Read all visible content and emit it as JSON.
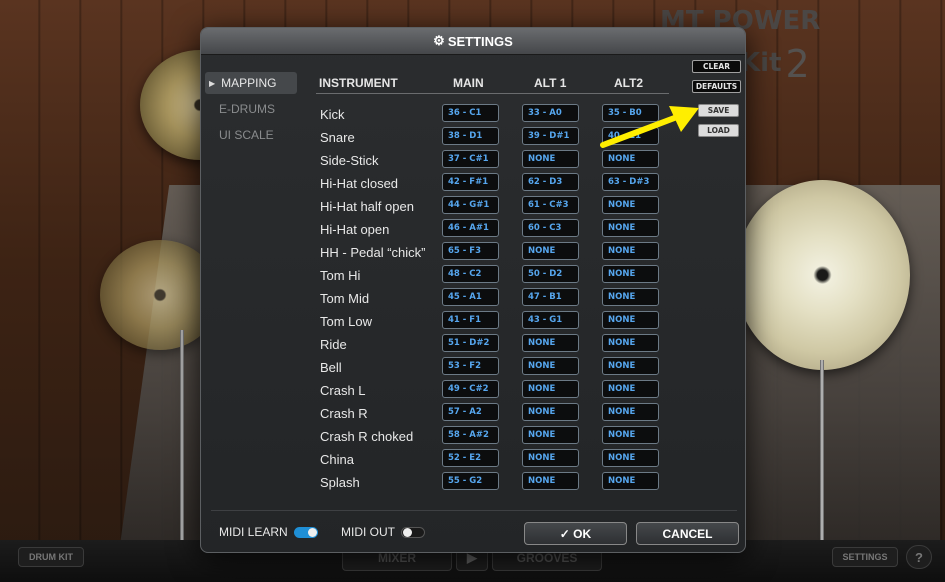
{
  "brand": {
    "text": "MT POWER DrumKit",
    "digit": "2"
  },
  "settings": {
    "title": "SETTINGS",
    "nav": [
      {
        "label": "MAPPING",
        "active": true
      },
      {
        "label": "E-DRUMS",
        "active": false
      },
      {
        "label": "UI SCALE",
        "active": false
      }
    ],
    "columns": {
      "instrument": "INSTRUMENT",
      "main": "MAIN",
      "alt1": "ALT 1",
      "alt2": "ALT2"
    },
    "rows": [
      {
        "instrument": "Kick",
        "main": "36 - C1",
        "alt1": "33 - A0",
        "alt2": "35 - B0"
      },
      {
        "instrument": "Snare",
        "main": "38 - D1",
        "alt1": "39 - D#1",
        "alt2": "40 - E1"
      },
      {
        "instrument": "Side-Stick",
        "main": "37 - C#1",
        "alt1": "NONE",
        "alt2": "NONE"
      },
      {
        "instrument": "Hi-Hat closed",
        "main": "42 - F#1",
        "alt1": "62 - D3",
        "alt2": "63 - D#3"
      },
      {
        "instrument": "Hi-Hat half open",
        "main": "44 - G#1",
        "alt1": "61 - C#3",
        "alt2": "NONE"
      },
      {
        "instrument": "Hi-Hat open",
        "main": "46 - A#1",
        "alt1": "60 - C3",
        "alt2": "NONE"
      },
      {
        "instrument": "HH - Pedal “chick”",
        "main": "65 - F3",
        "alt1": "NONE",
        "alt2": "NONE"
      },
      {
        "instrument": "Tom Hi",
        "main": "48 - C2",
        "alt1": "50 - D2",
        "alt2": "NONE"
      },
      {
        "instrument": "Tom Mid",
        "main": "45 - A1",
        "alt1": "47 - B1",
        "alt2": "NONE"
      },
      {
        "instrument": "Tom Low",
        "main": "41 - F1",
        "alt1": "43 - G1",
        "alt2": "NONE"
      },
      {
        "instrument": "Ride",
        "main": "51 - D#2",
        "alt1": "NONE",
        "alt2": "NONE"
      },
      {
        "instrument": "Bell",
        "main": "53 - F2",
        "alt1": "NONE",
        "alt2": "NONE"
      },
      {
        "instrument": "Crash L",
        "main": "49 - C#2",
        "alt1": "NONE",
        "alt2": "NONE"
      },
      {
        "instrument": "Crash R",
        "main": "57 - A2",
        "alt1": "NONE",
        "alt2": "NONE"
      },
      {
        "instrument": "Crash R choked",
        "main": "58 - A#2",
        "alt1": "NONE",
        "alt2": "NONE"
      },
      {
        "instrument": "China",
        "main": "52 - E2",
        "alt1": "NONE",
        "alt2": "NONE"
      },
      {
        "instrument": "Splash",
        "main": "55 - G2",
        "alt1": "NONE",
        "alt2": "NONE"
      }
    ],
    "side_buttons": {
      "clear": "CLEAR",
      "defaults": "DEFAULTS",
      "save": "SAVE",
      "load": "LOAD"
    },
    "midi_learn": {
      "label": "MIDI LEARN",
      "on": true
    },
    "midi_out": {
      "label": "MIDI OUT",
      "on": false
    },
    "ok": "✓ OK",
    "cancel": "CANCEL"
  },
  "bottom_bar": {
    "drum_kit": "DRUM KIT",
    "mixer": "MIXER",
    "grooves": "GROOVES",
    "settings": "SETTINGS",
    "help": "?"
  },
  "colors": {
    "note_text": "#56a6ee",
    "toggle_on": "#1f8fd6",
    "arrow": "#ffee00"
  }
}
